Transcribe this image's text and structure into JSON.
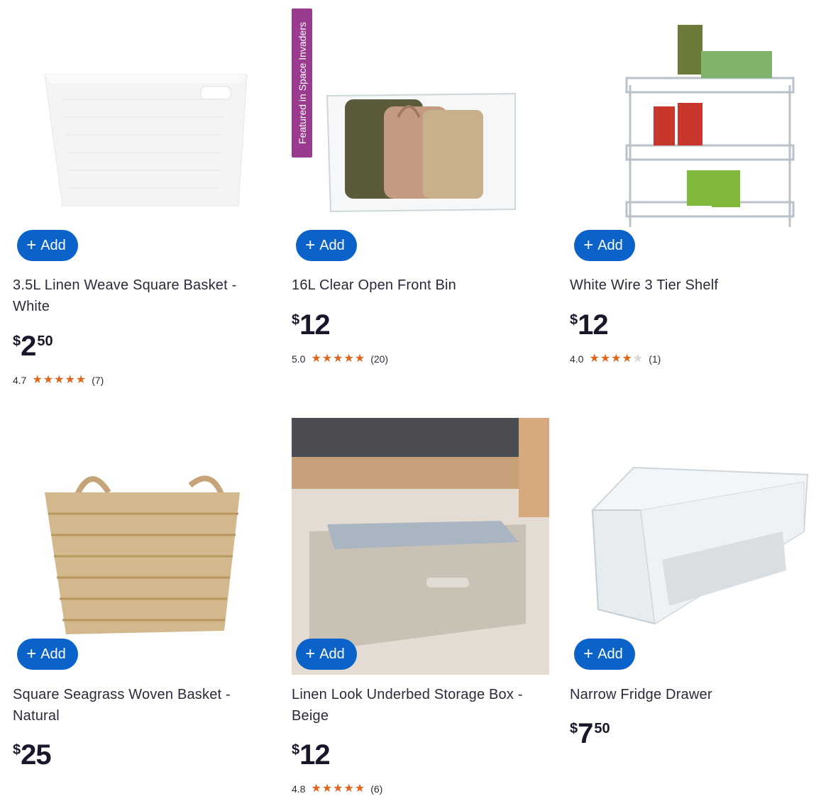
{
  "add_label": "Add",
  "products": [
    {
      "title": "3.5L Linen Weave Square Basket - White",
      "currency": "$",
      "dollars": "2",
      "cents": "50",
      "rating": "4.7",
      "reviews": "(7)",
      "stars": 4.7
    },
    {
      "title": "16L Clear Open Front Bin",
      "currency": "$",
      "dollars": "12",
      "cents": "",
      "rating": "5.0",
      "reviews": "(20)",
      "stars": 5,
      "badge": "Featured in Space Invaders"
    },
    {
      "title": "White Wire 3 Tier Shelf",
      "currency": "$",
      "dollars": "12",
      "cents": "",
      "rating": "4.0",
      "reviews": "(1)",
      "stars": 4
    },
    {
      "title": "Square Seagrass Woven Basket - Natural",
      "currency": "$",
      "dollars": "25",
      "cents": ""
    },
    {
      "title": "Linen Look Underbed Storage Box - Beige",
      "currency": "$",
      "dollars": "12",
      "cents": "",
      "rating": "4.8",
      "reviews": "(6)",
      "stars": 4.8
    },
    {
      "title": "Narrow Fridge Drawer",
      "currency": "$",
      "dollars": "7",
      "cents": "50"
    }
  ],
  "colors": {
    "add_button": "#0b63c9",
    "star": "#e0661c",
    "badge": "#9a3b8f"
  }
}
